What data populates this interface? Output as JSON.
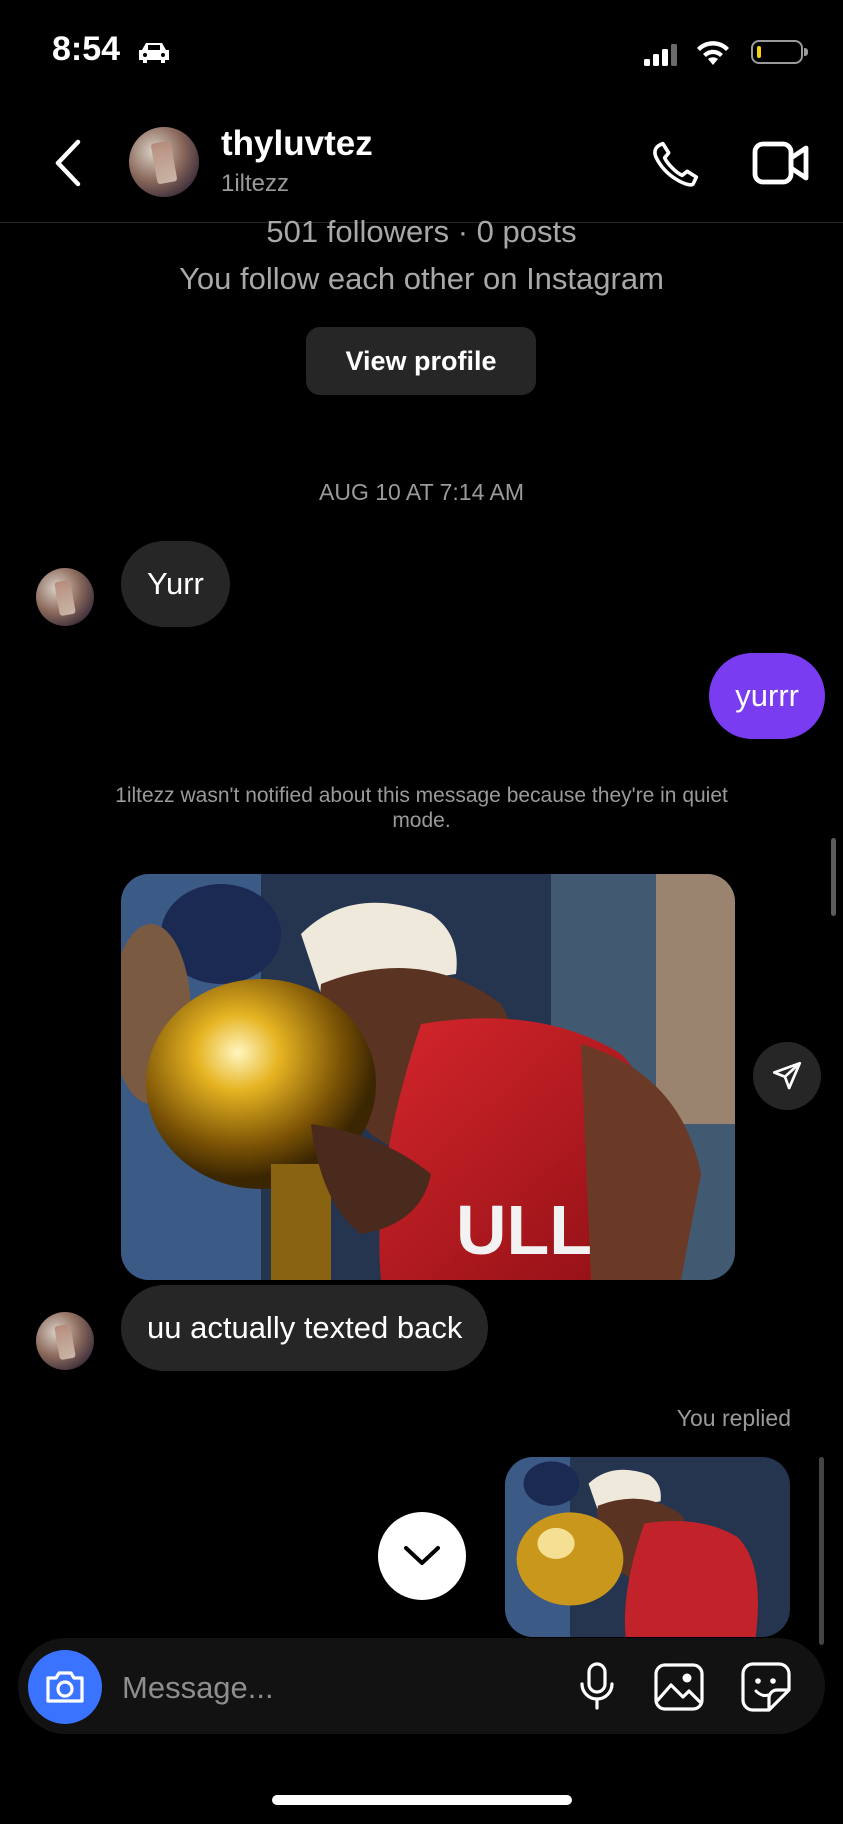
{
  "status_bar": {
    "time": "8:54"
  },
  "header": {
    "name": "thyluvtez",
    "username": "1iltezz"
  },
  "profile": {
    "stats": "501 followers · 0 posts",
    "mutual": "You follow each other on Instagram",
    "view_profile_label": "View profile"
  },
  "thread": {
    "timestamp": "AUG 10 AT 7:14 AM",
    "msg1": "Yurr",
    "msg2": "yurrr",
    "quiet_notice": "1iltezz wasn't notified about this message because they're in quiet mode.",
    "msg3": "uu actually texted back",
    "replied_label": "You replied"
  },
  "composer": {
    "placeholder": "Message..."
  },
  "colors": {
    "accent": "#7a3cf0",
    "camera": "#3a73ff",
    "bubble": "#262626"
  }
}
